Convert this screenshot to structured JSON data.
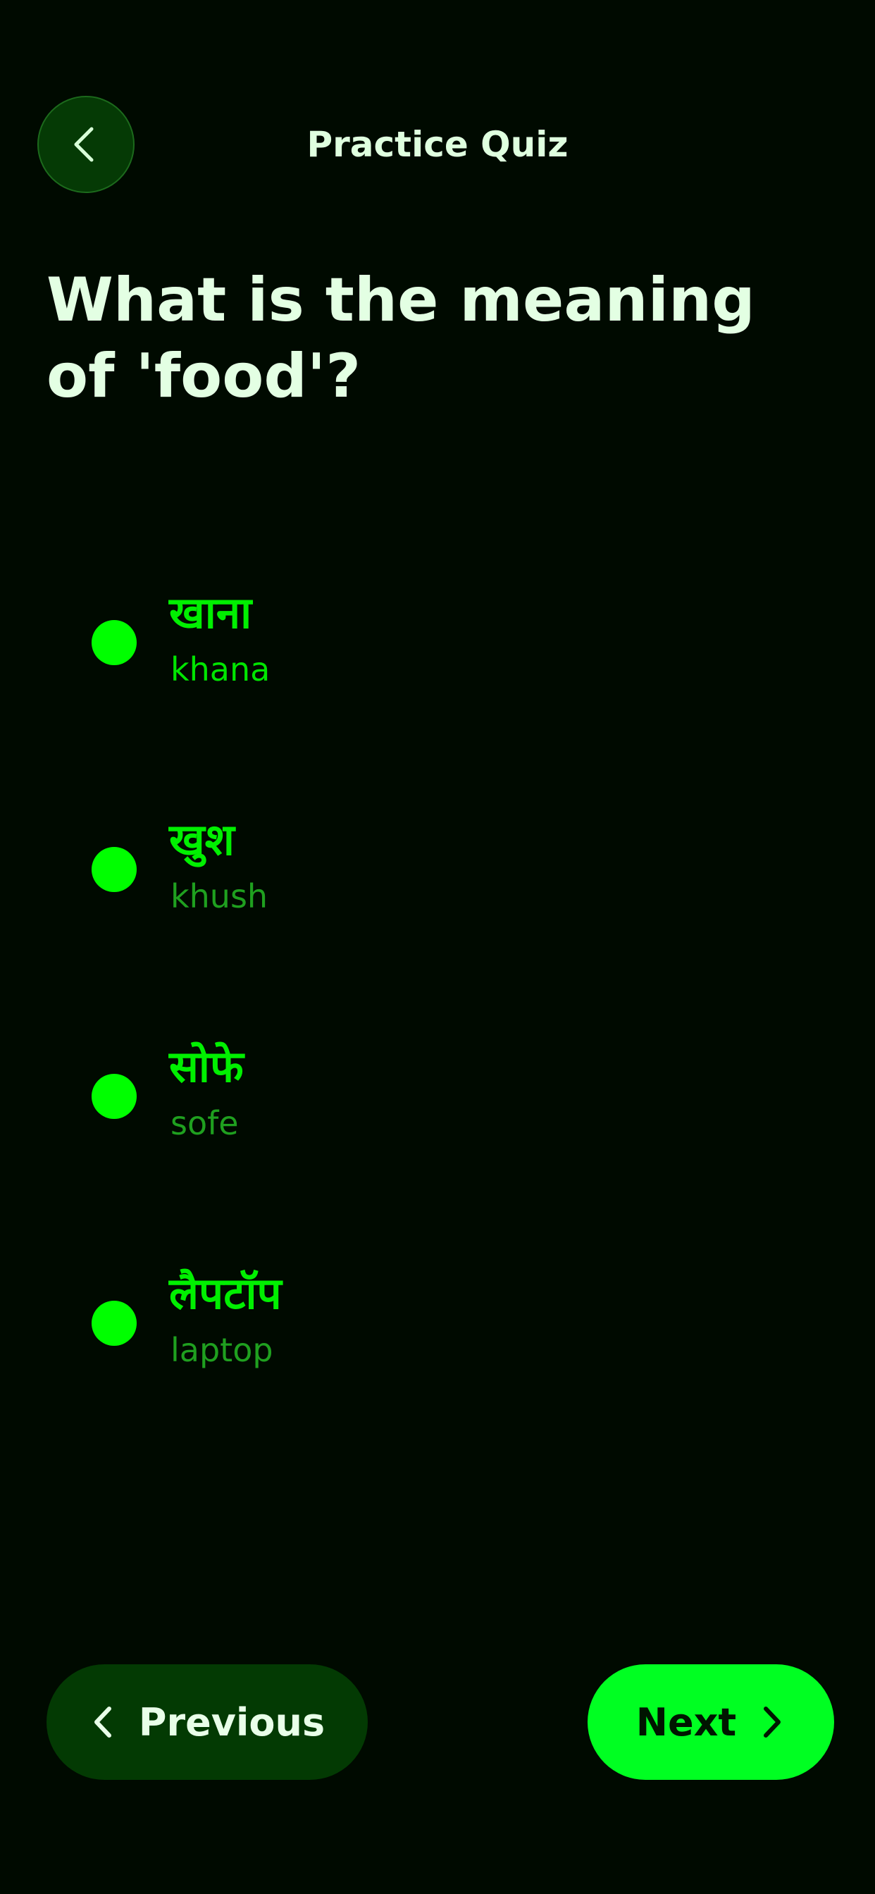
{
  "header": {
    "title": "Practice Quiz",
    "back_icon": "chevron-left-icon"
  },
  "question": {
    "text": "What is the meaning of 'food'?"
  },
  "options": [
    {
      "native": "खाना",
      "translit": "khana"
    },
    {
      "native": "खुश",
      "translit": "khush"
    },
    {
      "native": "सोफे",
      "translit": "sofe"
    },
    {
      "native": "लैपटॉप",
      "translit": "laptop"
    }
  ],
  "footer": {
    "previous_label": "Previous",
    "next_label": "Next",
    "previous_icon": "chevron-left-icon",
    "next_icon": "chevron-right-icon"
  },
  "colors": {
    "background": "#000a00",
    "accent": "#00ff00",
    "dark_green": "#033a03",
    "text": "#e3ffe3"
  }
}
